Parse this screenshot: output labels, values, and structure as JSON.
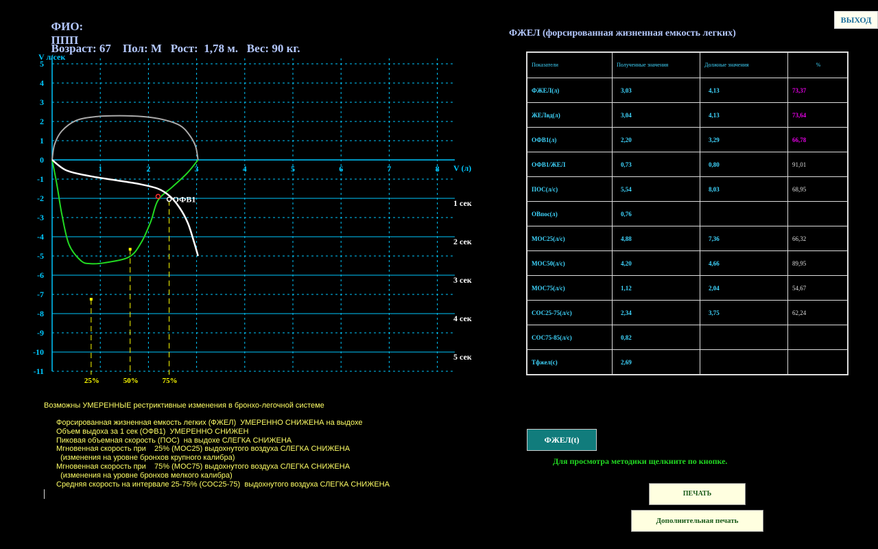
{
  "header": {
    "fio_label": "ФИО:",
    "fio_value": "ППП",
    "age": "Возраст: 67",
    "sex": "Пол: М",
    "height": "Рост:  1,78 м.",
    "weight": "Вес: 90 кг."
  },
  "exit_label": "ВЫХОД",
  "table_title": "ФЖЕЛ (форсированная жизненная емкость легких)",
  "table": {
    "headers": [
      "Показатели",
      "Полученные значения",
      "Должные значения",
      "%"
    ],
    "rows": [
      {
        "name": "ФЖЕЛ(л)",
        "got": "3,03",
        "due": "4,13",
        "pct": "73,37",
        "pct_color": "pink"
      },
      {
        "name": "ЖЕЛвд(л)",
        "got": "3,04",
        "due": "4,13",
        "pct": "73,64",
        "pct_color": "pink"
      },
      {
        "name": "ОФВ1(л)",
        "got": "2,20",
        "due": "3,29",
        "pct": "66,78",
        "pct_color": "pink"
      },
      {
        "name": "ОФВ1/ЖЕЛ",
        "got": "0,73",
        "due": "0,80",
        "pct": "91,01",
        "pct_color": "white"
      },
      {
        "name": "ПОС(л/с)",
        "got": "5,54",
        "due": "8,03",
        "pct": "68,95",
        "pct_color": "white"
      },
      {
        "name": "ОВпос(л)",
        "got": "0,76",
        "due": "",
        "pct": "",
        "pct_color": "white"
      },
      {
        "name": "МОС25(л/с)",
        "got": "4,88",
        "due": "7,36",
        "pct": "66,32",
        "pct_color": "white"
      },
      {
        "name": "МОС50(л/с)",
        "got": "4,20",
        "due": "4,66",
        "pct": "89,95",
        "pct_color": "white"
      },
      {
        "name": "МОС75(л/с)",
        "got": "1,12",
        "due": "2,04",
        "pct": "54,67",
        "pct_color": "white"
      },
      {
        "name": "СОС25-75(л/с)",
        "got": "2,34",
        "due": "3,75",
        "pct": "62,24",
        "pct_color": "white"
      },
      {
        "name": "СОС75-85(л/с)",
        "got": "0,82",
        "due": "",
        "pct": "",
        "pct_color": "white"
      },
      {
        "name": "Тфжел(с)",
        "got": "2,69",
        "due": "",
        "pct": "",
        "pct_color": "white"
      }
    ]
  },
  "chart_data": {
    "type": "line",
    "ylabel": "V л/сек",
    "xlabel": "V (л)",
    "xlim": [
      0,
      8.5
    ],
    "ylim": [
      -11,
      5
    ],
    "x_ticks": [
      1,
      2,
      3,
      4,
      5,
      6,
      7,
      8
    ],
    "y_ticks": [
      5,
      4,
      3,
      2,
      1,
      0,
      -1,
      -2,
      -3,
      -4,
      -5,
      -6,
      -7,
      -8,
      -9,
      -10,
      -11
    ],
    "time_labels": [
      "1 сек",
      "2 сек",
      "3 сек",
      "4 сек",
      "5 сек"
    ],
    "percent_markers": [
      {
        "label": "25%",
        "x": 0.81,
        "y": -7.25
      },
      {
        "label": "50%",
        "x": 1.62,
        "y": -4.65
      },
      {
        "label": "75%",
        "x": 2.43,
        "y": -2.1
      }
    ],
    "ofv1_label": "ОФВ1",
    "ofv1_point": {
      "x": 2.2,
      "y": -1.9
    },
    "colors": {
      "grid": "#00c8ff",
      "flow_inspiratory": "#aaaaaa",
      "flow_expiratory": "#22d922",
      "volume_time": "#ffffff",
      "markers": "#ffff00"
    },
    "series": [
      {
        "key": "upper-loop",
        "values": [
          [
            0,
            0
          ],
          [
            0.05,
            0.8
          ],
          [
            0.2,
            1.5
          ],
          [
            0.5,
            2.05
          ],
          [
            0.9,
            2.25
          ],
          [
            1.4,
            2.3
          ],
          [
            1.9,
            2.25
          ],
          [
            2.3,
            2.1
          ],
          [
            2.65,
            1.8
          ],
          [
            2.85,
            1.3
          ],
          [
            2.98,
            0.7
          ],
          [
            3.03,
            0
          ]
        ]
      },
      {
        "key": "lower-loop",
        "values": [
          [
            0,
            0
          ],
          [
            0.1,
            -1.3
          ],
          [
            0.2,
            -2.8
          ],
          [
            0.35,
            -4.4
          ],
          [
            0.6,
            -5.25
          ],
          [
            0.8,
            -5.4
          ],
          [
            1.1,
            -5.35
          ],
          [
            1.6,
            -5.05
          ],
          [
            1.85,
            -4.3
          ],
          [
            2.05,
            -3.2
          ],
          [
            2.2,
            -2.1
          ],
          [
            2.5,
            -1.4
          ],
          [
            2.8,
            -0.7
          ],
          [
            3.03,
            0
          ]
        ]
      },
      {
        "key": "volume-time",
        "values": [
          [
            0,
            0
          ],
          [
            0.3,
            -0.55
          ],
          [
            0.8,
            -0.85
          ],
          [
            1.3,
            -1.05
          ],
          [
            1.8,
            -1.25
          ],
          [
            2.2,
            -1.5
          ],
          [
            2.45,
            -1.9
          ],
          [
            2.65,
            -2.5
          ],
          [
            2.82,
            -3.3
          ],
          [
            2.95,
            -4.3
          ],
          [
            3.03,
            -5.0
          ]
        ]
      }
    ]
  },
  "diagnosis": "Возможны УМЕРЕННЫЕ рестриктивные изменения в бронхо-легочной системе",
  "findings": [
    "Форсированная жизненная емкость легких (ФЖЕЛ)  УМЕРЕННО СНИЖЕНА на выдохе",
    "Объем выдоха за 1 сек (ОФВ1)  УМЕРЕННО СНИЖЕН",
    "Пиковая объемная скорость (ПОС)  на выдохе СЛЕГКА СНИЖЕНА",
    "Мгновенная скорость при    25% (МОС25) выдохнутого воздуха СЛЕГКА СНИЖЕНА",
    "  (изменения на уровне бронхов крупного калибра)",
    "Мгновенная скорость при    75% (МОС75) выдохнутого воздуха СЛЕГКА СНИЖЕНА",
    "  (изменения на уровне бронхов мелкого калибра)",
    "Средняя скорость на интервале 25-75% (СОС25-75)  выдохнутого воздуха СЛЕГКА СНИЖЕНА"
  ],
  "fzhel_button": "ФЖЕЛ(t)",
  "method_hint": "Для просмотра методики щелкните по кнопке.",
  "print_button": "ПЕЧАТЬ",
  "extra_print_button": "Дополнительная печать"
}
